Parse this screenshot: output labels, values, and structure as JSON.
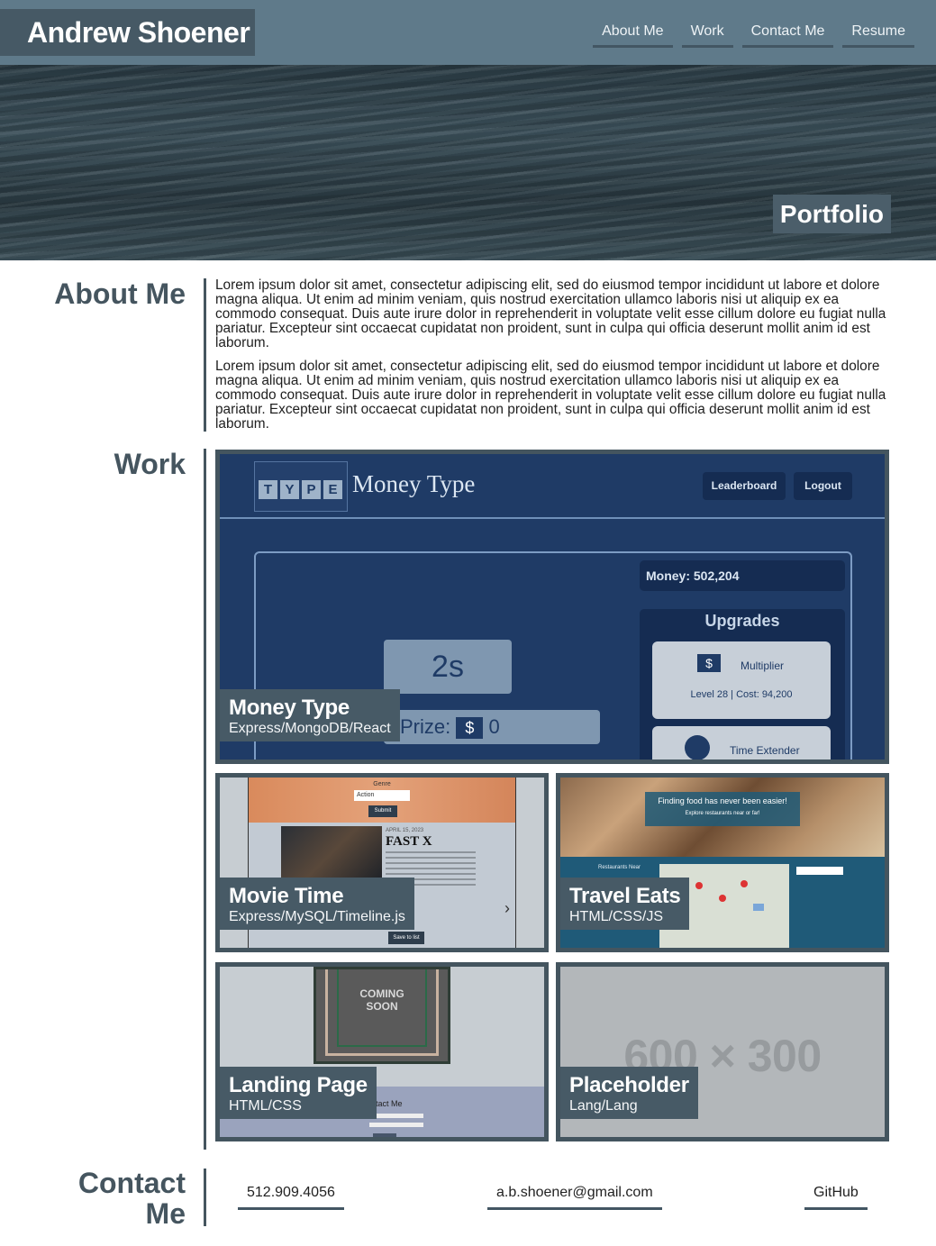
{
  "header": {
    "name": "Andrew Shoener",
    "nav": [
      "About Me",
      "Work",
      "Contact Me",
      "Resume"
    ]
  },
  "hero": {
    "tag": "Portfolio"
  },
  "about": {
    "title": "About Me",
    "paragraphs": [
      "Lorem ipsum dolor sit amet, consectetur adipiscing elit, sed do eiusmod tempor incididunt ut labore et dolore magna aliqua. Ut enim ad minim veniam, quis nostrud exercitation ullamco laboris nisi ut aliquip ex ea commodo consequat. Duis aute irure dolor in reprehenderit in voluptate velit esse cillum dolore eu fugiat nulla pariatur. Excepteur sint occaecat cupidatat non proident, sunt in culpa qui officia deserunt mollit anim id est laborum.",
      "Lorem ipsum dolor sit amet, consectetur adipiscing elit, sed do eiusmod tempor incididunt ut labore et dolore magna aliqua. Ut enim ad minim veniam, quis nostrud exercitation ullamco laboris nisi ut aliquip ex ea commodo consequat. Duis aute irure dolor in reprehenderit in voluptate velit esse cillum dolore eu fugiat nulla pariatur. Excepteur sint occaecat cupidatat non proident, sunt in culpa qui officia deserunt mollit anim id est laborum."
    ]
  },
  "work": {
    "title": "Work",
    "projects": [
      {
        "title": "Money Type",
        "tech": "Express/MongoDB/React",
        "shot": {
          "logo_letters": [
            "T",
            "Y",
            "P",
            "E"
          ],
          "app_name": "Money Type",
          "buttons": [
            "Leaderboard",
            "Logout"
          ],
          "money": "Money: 502,204",
          "upgrades_title": "Upgrades",
          "timer": "2s",
          "prize_label": "Prize:",
          "prize_symbol": "$",
          "prize_value": "0",
          "upgrade1_name": "Multiplier",
          "upgrade1_info": "Level 28 | Cost: 94,200",
          "upgrade2_name": "Time Extender"
        }
      },
      {
        "title": "Movie Time",
        "tech": "Express/MySQL/Timeline.js",
        "shot": {
          "genre_label": "Genre",
          "genre_value": "Action",
          "submit": "Submit",
          "date": "APRIL 15, 2023",
          "movie": "FAST X",
          "save": "Save to list"
        }
      },
      {
        "title": "Travel Eats",
        "tech": "HTML/CSS/JS",
        "shot": {
          "banner_title": "Finding food has never been easier!",
          "banner_sub": "Explore restaurants near or far!",
          "near_label": "Restaurants Near"
        }
      },
      {
        "title": "Landing Page",
        "tech": "HTML/CSS",
        "shot": {
          "coming": "COMING",
          "soon": "SOON",
          "contact": "ntact Me"
        }
      },
      {
        "title": "Placeholder",
        "tech": "Lang/Lang",
        "shot": {
          "dims": "600 × 300"
        }
      }
    ]
  },
  "contact": {
    "title_line1": "Contact",
    "title_line2": "Me",
    "phone": "512.909.4056",
    "email": "a.b.shoener@gmail.com",
    "github": "GitHub"
  },
  "colors": {
    "accent": "#45555f",
    "header": "#5f7a8a",
    "caption": "#475a66"
  }
}
